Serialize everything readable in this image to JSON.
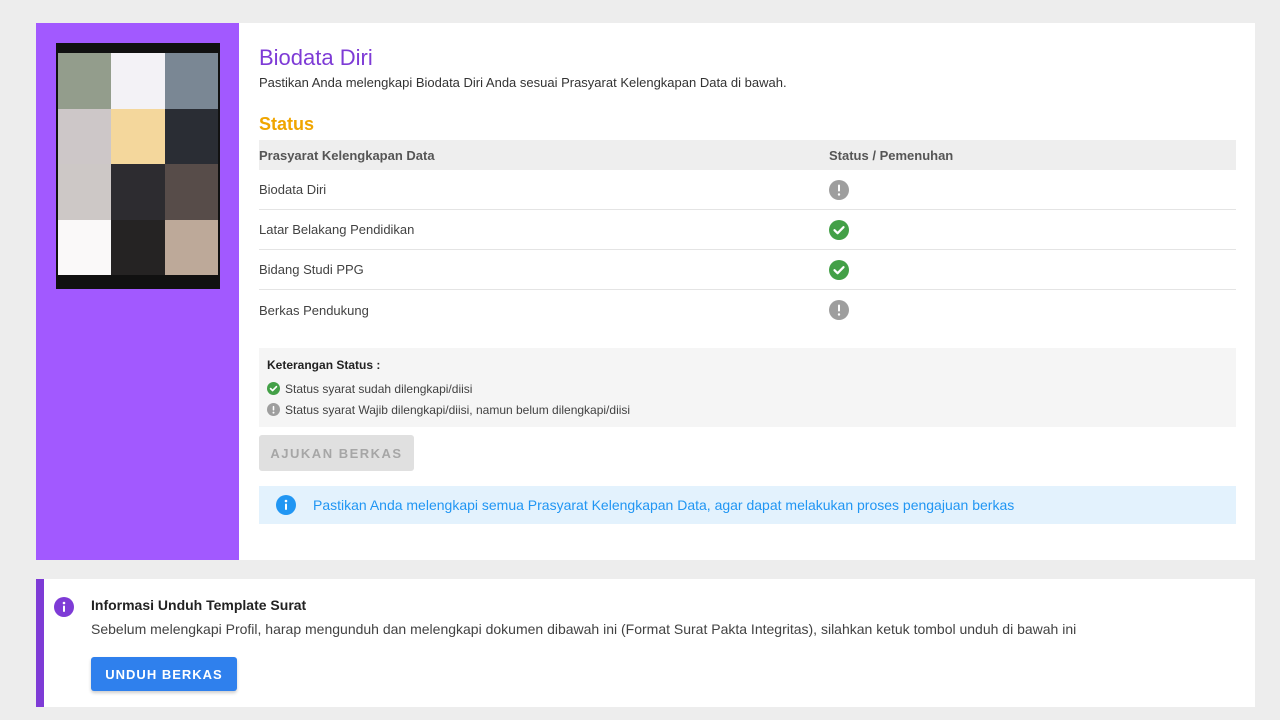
{
  "biodata": {
    "title": "Biodata Diri",
    "subtitle": "Pastikan Anda melengkapi Biodata Diri Anda sesuai Prasyarat Kelengkapan Data di bawah.",
    "status_heading": "Status",
    "table": {
      "headers": [
        "Prasyarat Kelengkapan Data",
        "Status / Pemenuhan"
      ],
      "rows": [
        {
          "label": "Biodata Diri",
          "status": "incomplete"
        },
        {
          "label": "Latar Belakang Pendidikan",
          "status": "complete"
        },
        {
          "label": "Bidang Studi PPG",
          "status": "complete"
        },
        {
          "label": "Berkas Pendukung",
          "status": "incomplete"
        }
      ]
    },
    "legend": {
      "title": "Keterangan Status :",
      "complete": "Status syarat sudah dilengkapi/diisi",
      "incomplete": "Status syarat Wajib dilengkapi/diisi, namun belum dilengkapi/diisi"
    },
    "submit_label": "AJUKAN BERKAS",
    "notice": "Pastikan Anda melengkapi semua Prasyarat Kelengkapan Data, agar dapat melakukan proses pengajuan berkas"
  },
  "template_info": {
    "title": "Informasi Unduh Template Surat",
    "text": "Sebelum melengkapi Profil, harap mengunduh dan melengkapi dokumen dibawah ini (Format Surat Pakta Integritas), silahkan ketuk tombol unduh di bawah ini",
    "button_label": "UNDUH BERKAS"
  },
  "colors": {
    "sidebar": "#a259ff",
    "title": "#7e3bd6",
    "status_heading": "#f0a500",
    "complete": "#43a047",
    "incomplete": "#9e9e9e",
    "info": "#2196f3",
    "download_button": "#2f80ed"
  },
  "icons": {
    "complete": "check-circle-icon",
    "incomplete": "exclamation-circle-icon",
    "info": "info-circle-icon"
  }
}
